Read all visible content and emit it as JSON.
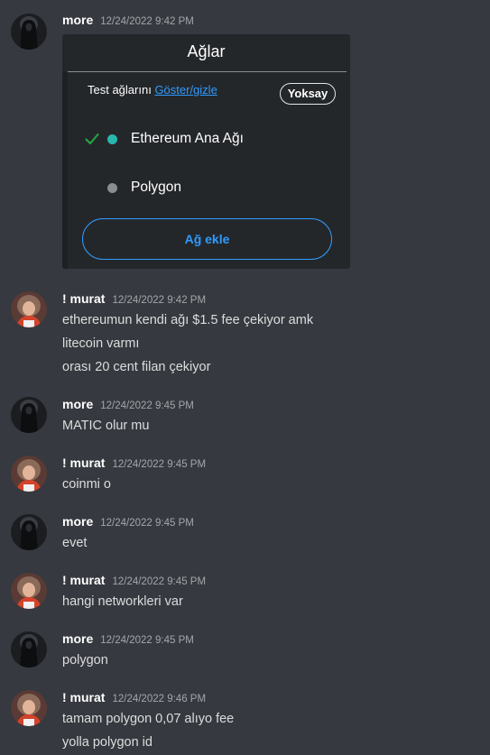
{
  "colors": {
    "background": "#36393f",
    "username": "#ffffff",
    "timestamp": "#a3a6aa",
    "message_text": "#dcddde",
    "link_blue": "#2f9bff",
    "ethereum_dot": "#29b6af",
    "polygon_dot": "#8a8d91",
    "check_green": "#28a745"
  },
  "messages": [
    {
      "author": "more",
      "timestamp": "12/24/2022 9:42 PM",
      "avatar": "dark-figure-avatar",
      "lines": []
    },
    {
      "author": "! murat",
      "timestamp": "12/24/2022 9:42 PM",
      "avatar": "anime-girl-avatar",
      "lines": [
        "ethereumun kendi ağı $1.5 fee çekiyor amk",
        "litecoin varmı",
        "orası 20 cent filan çekiyor"
      ]
    },
    {
      "author": "more",
      "timestamp": "12/24/2022 9:45 PM",
      "avatar": "dark-figure-avatar",
      "lines": [
        "MATIC olur mu"
      ]
    },
    {
      "author": "! murat",
      "timestamp": "12/24/2022 9:45 PM",
      "avatar": "anime-girl-avatar",
      "lines": [
        "coinmi o"
      ]
    },
    {
      "author": "more",
      "timestamp": "12/24/2022 9:45 PM",
      "avatar": "dark-figure-avatar",
      "lines": [
        "evet"
      ]
    },
    {
      "author": "! murat",
      "timestamp": "12/24/2022 9:45 PM",
      "avatar": "anime-girl-avatar",
      "lines": [
        "hangi networkleri var"
      ]
    },
    {
      "author": "more",
      "timestamp": "12/24/2022 9:45 PM",
      "avatar": "dark-figure-avatar",
      "lines": [
        "polygon"
      ]
    },
    {
      "author": "! murat",
      "timestamp": "12/24/2022 9:46 PM",
      "avatar": "anime-girl-avatar",
      "lines": [
        "tamam polygon 0,07 alıyo fee",
        "yolla polygon id"
      ]
    }
  ],
  "embed": {
    "title": "Ağlar",
    "test_networks_prefix": "Test ağlarını ",
    "test_networks_link": "Göster/gizle",
    "ignore_button": "Yoksay",
    "networks": [
      {
        "label": "Ethereum Ana Ağı",
        "selected": true,
        "dot_color": "#29b6af"
      },
      {
        "label": "Polygon",
        "selected": false,
        "dot_color": "#8a8d91"
      }
    ],
    "add_network_button": "Ağ ekle"
  }
}
